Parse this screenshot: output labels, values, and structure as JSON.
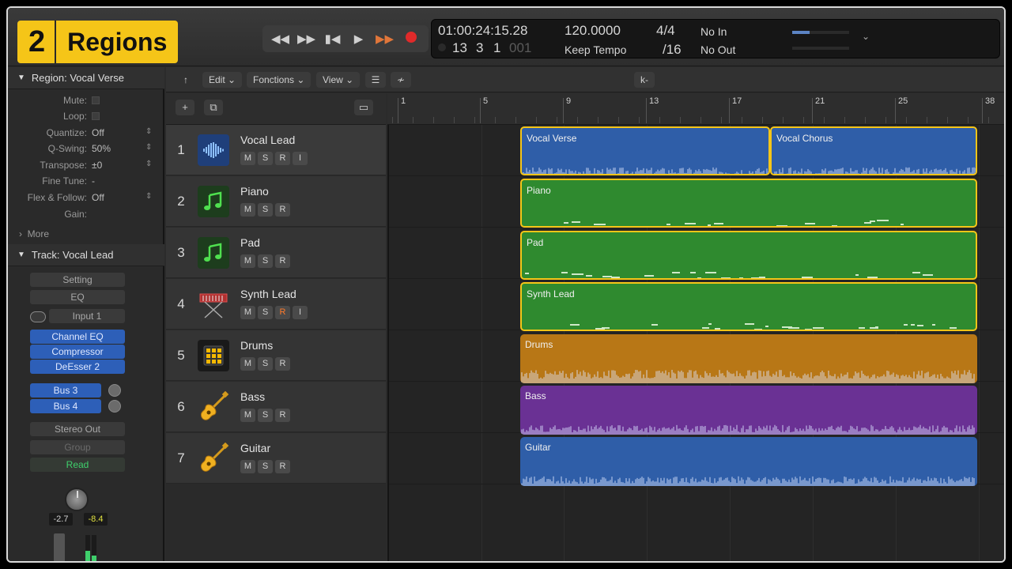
{
  "badge": {
    "number": "2",
    "label": "Regions"
  },
  "transport": {
    "rewind": "◀◀",
    "forward": "▶▶",
    "to_start": "▮◀",
    "play": "▶",
    "cycle": "▶▶"
  },
  "lcd": {
    "timecode": "01:00:24:15.28",
    "bars": "13",
    "beats": "3",
    "div": "1",
    "ticks": "001",
    "tempo": "120.0000",
    "tempo_mode": "Keep Tempo",
    "signature": "4/4",
    "division": "/16",
    "in": "No In",
    "out": "No Out"
  },
  "inspector": {
    "region_header": "Region: Vocal Verse",
    "params": [
      {
        "key": "Mute:",
        "value": ""
      },
      {
        "key": "Loop:",
        "value": ""
      },
      {
        "key": "Quantize:",
        "value": "Off"
      },
      {
        "key": "Q-Swing:",
        "value": "50%"
      },
      {
        "key": "Transpose:",
        "value": "±0"
      },
      {
        "key": "Fine Tune:",
        "value": "-"
      },
      {
        "key": "Flex & Follow:",
        "value": "Off"
      },
      {
        "key": "Gain:",
        "value": ""
      }
    ],
    "more": "More",
    "track_header": "Track:  Vocal Lead",
    "setting": "Setting",
    "eq": "EQ",
    "input": "Input 1",
    "plugins": [
      "Channel EQ",
      "Compressor",
      "DeEsser 2"
    ],
    "sends": [
      "Bus 3",
      "Bus 4"
    ],
    "output": "Stereo Out",
    "group": "Group",
    "automation": "Read",
    "level_left": "-2.7",
    "level_right": "-8.4"
  },
  "toolbar": {
    "edit": "Edit",
    "functions": "Fonctions",
    "view": "View",
    "catch": "k-"
  },
  "ruler": {
    "bars": [
      "1",
      "5",
      "9",
      "13",
      "17",
      "21",
      "25",
      "38"
    ]
  },
  "tracks": [
    {
      "num": "1",
      "name": "Vocal Lead",
      "icon": "waveform-icon"
    },
    {
      "num": "2",
      "name": "Piano",
      "icon": "music-note-icon"
    },
    {
      "num": "3",
      "name": "Pad",
      "icon": "music-note-icon"
    },
    {
      "num": "4",
      "name": "Synth Lead",
      "icon": "keyboard-icon"
    },
    {
      "num": "5",
      "name": "Drums",
      "icon": "drum-pad-icon"
    },
    {
      "num": "6",
      "name": "Bass",
      "icon": "guitar-icon"
    },
    {
      "num": "7",
      "name": "Guitar",
      "icon": "guitar-icon"
    }
  ],
  "track_buttons": {
    "mute": "M",
    "solo": "S",
    "record": "R",
    "input": "I"
  },
  "regions": [
    {
      "name": "Vocal Verse",
      "color": "#2f5ea8",
      "kind": "audio",
      "selected": true
    },
    {
      "name": "Vocal Chorus",
      "color": "#2f5ea8",
      "kind": "audio",
      "selected": true
    },
    {
      "name": "Piano",
      "color": "#2f8a2f",
      "kind": "midi",
      "selected": true
    },
    {
      "name": "Pad",
      "color": "#2f8a2f",
      "kind": "midi",
      "selected": true
    },
    {
      "name": "Synth Lead",
      "color": "#2f8a2f",
      "kind": "midi",
      "selected": true
    },
    {
      "name": "Drums",
      "color": "#b87716",
      "kind": "audio",
      "selected": false
    },
    {
      "name": "Bass",
      "color": "#6a3194",
      "kind": "audio",
      "selected": false
    },
    {
      "name": "Guitar",
      "color": "#2f5ea8",
      "kind": "audio",
      "selected": false
    }
  ],
  "colors": {
    "selection": "#f5c518",
    "record": "#e02a2a",
    "green_led": "#3fd06c"
  }
}
